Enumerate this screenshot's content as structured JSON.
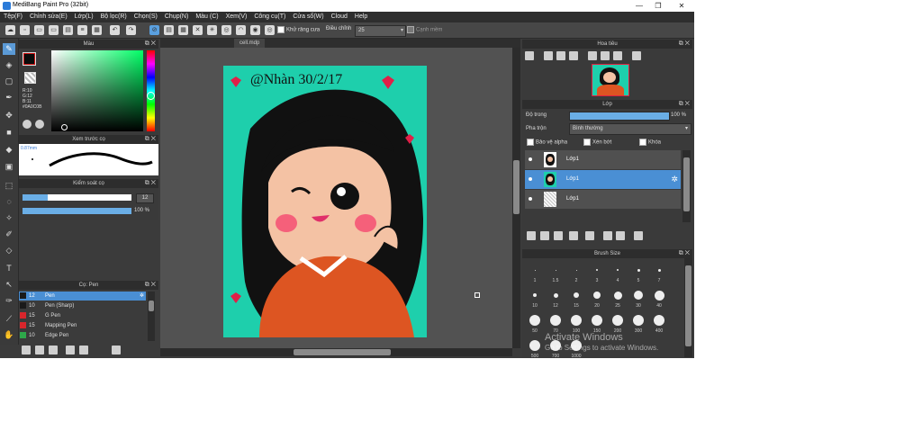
{
  "window": {
    "title": "MediBang Paint Pro (32bit)",
    "minimize": "—",
    "maximize": "❐",
    "close": "✕"
  },
  "menu": [
    "Tệp(F)",
    "Chỉnh sửa(E)",
    "Lớp(L)",
    "Bộ lọc(R)",
    "Chọn(S)",
    "Chụp(N)",
    "Màu (C)",
    "Xem(V)",
    "Công cụ(T)",
    "Cửa sổ(W)",
    "Cloud",
    "Help"
  ],
  "toolbar": {
    "antialias_label": "Khử răng cưa",
    "adjust_label": "Điều chỉnh",
    "adjust_value": "25",
    "edge_label": "Cạnh mềm"
  },
  "color_panel": {
    "title": "Màu",
    "r": "R:10",
    "g": "G:12",
    "b": "B:11",
    "hex": "#0A0C0B",
    "primary_color": "#0a0c0b",
    "accent": "#cc1111"
  },
  "brush_preview": {
    "title": "Xem trước cọ",
    "size": "0.87mm"
  },
  "brush_control": {
    "title": "Kiểm soát cọ",
    "size_value": "12",
    "opacity_value": "100 %"
  },
  "brush_list": {
    "title": "Cọ: Pen",
    "items": [
      {
        "size": "12",
        "name": "Pen",
        "color": "#1a1a1a"
      },
      {
        "size": "10",
        "name": "Pen (Sharp)",
        "color": "#1a1a1a"
      },
      {
        "size": "15",
        "name": "G Pen",
        "color": "#d8262c"
      },
      {
        "size": "15",
        "name": "Mapping Pen",
        "color": "#d8262c"
      },
      {
        "size": "10",
        "name": "Edge Pen",
        "color": "#2ea84a"
      }
    ]
  },
  "canvas": {
    "tab_label": "cell.mdp",
    "background": "#1ecfac",
    "signature": "@Nhàn 30/2/17"
  },
  "navigator": {
    "title": "Hoa tiêu"
  },
  "layer_panel": {
    "title": "Lớp",
    "opacity_label": "Độ trong",
    "opacity_value": "100 %",
    "blend_label": "Pha trộn",
    "blend_value": "Bình thường",
    "protect_alpha": "Bảo vệ alpha",
    "clipping": "Xén bớt",
    "lock": "Khóa",
    "layers": [
      {
        "name": "Lớp1",
        "selected": false
      },
      {
        "name": "Lớp1",
        "selected": true
      },
      {
        "name": "Lớp1",
        "selected": false
      }
    ]
  },
  "brush_size": {
    "title": "Brush Size",
    "sizes": [
      "1",
      "1.5",
      "2",
      "3",
      "4",
      "5",
      "7",
      "10",
      "12",
      "15",
      "20",
      "25",
      "30",
      "40",
      "50",
      "70",
      "100",
      "150",
      "200",
      "300",
      "400",
      "500",
      "700",
      "1000"
    ]
  },
  "watermark": {
    "line1": "Activate Windows",
    "line2": "Go to Settings to activate Windows."
  }
}
